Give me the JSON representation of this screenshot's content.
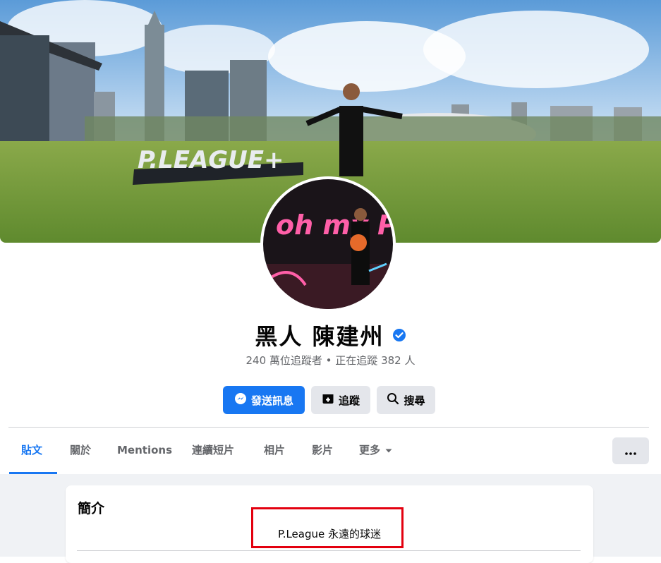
{
  "cover": {
    "sign_text": "P.LEAGUE+"
  },
  "avatar": {
    "art_text": "oh my PLG"
  },
  "profile": {
    "name": "黑人 陳建州",
    "stats": "240 萬位追蹤者 • 正在追蹤 382 人"
  },
  "actions": {
    "message_label": "發送訊息",
    "follow_label": "追蹤",
    "search_label": "搜尋"
  },
  "tabs": [
    {
      "label": "貼文"
    },
    {
      "label": "關於"
    },
    {
      "label": "Mentions"
    },
    {
      "label": "連續短片"
    },
    {
      "label": "相片"
    },
    {
      "label": "影片"
    },
    {
      "label": "更多"
    }
  ],
  "intro": {
    "title": "簡介",
    "bio": "P.League 永遠的球迷"
  },
  "colors": {
    "accent": "#1877f2",
    "highlight": "#e3000f",
    "verified": "#1877f2"
  }
}
